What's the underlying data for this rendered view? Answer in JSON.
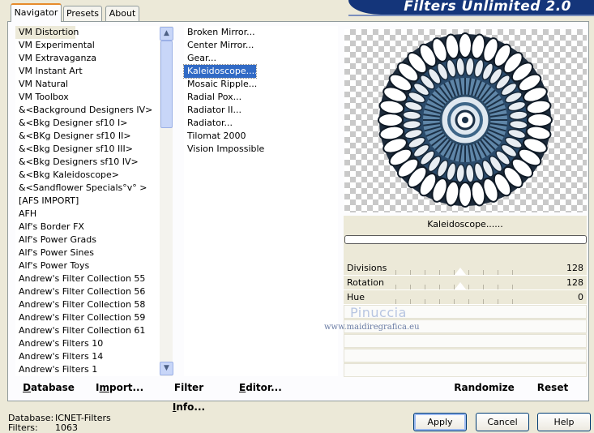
{
  "banner": {
    "title": "Filters Unlimited 2.0"
  },
  "tabs": [
    {
      "label": "Navigator",
      "active": true
    },
    {
      "label": "Presets",
      "active": false
    },
    {
      "label": "About",
      "active": false
    }
  ],
  "categories": [
    "VM Distortion",
    "VM Experimental",
    "VM Extravaganza",
    "VM Instant Art",
    "VM Natural",
    "VM Toolbox",
    "&<Background Designers IV>",
    "&<Bkg Designer sf10 I>",
    "&<BKg Designer sf10 II>",
    "&<Bkg Designer sf10 III>",
    "&<Bkg Designers sf10 IV>",
    "&<Bkg Kaleidoscope>",
    "&<Sandflower Specials°v° >",
    "[AFS IMPORT]",
    "AFH",
    "Alf's Border FX",
    "Alf's Power Grads",
    "Alf's Power Sines",
    "Alf's Power Toys",
    "Andrew's Filter Collection 55",
    "Andrew's Filter Collection 56",
    "Andrew's Filter Collection 58",
    "Andrew's Filter Collection 59",
    "Andrew's Filter Collection 61",
    "Andrew's Filters 10",
    "Andrew's Filters 14",
    "Andrew's Filters 1"
  ],
  "filters": [
    "Broken Mirror...",
    "Center Mirror...",
    "Gear...",
    "Kaleidoscope......",
    "Mosaic Ripple...",
    "Radial Pox...",
    "Radiator II...",
    "Radiator...",
    "Tilomat 2000",
    "Vision Impossible"
  ],
  "selected_filter_name": "Kaleidoscope......",
  "params": [
    {
      "label": "Divisions",
      "value": "128",
      "level": 128
    },
    {
      "label": "Rotation",
      "value": "128",
      "level": 128
    },
    {
      "label": "Hue",
      "value": "0",
      "level": 0
    }
  ],
  "watermark": {
    "name": "Pinuccia",
    "url": "www.maidiregrafica.eu"
  },
  "toolbar": {
    "database": {
      "hot": "D",
      "rest": "atabase"
    },
    "import": {
      "pre": "I",
      "hot": "m",
      "rest": "port..."
    },
    "filter_info": {
      "pre": "Filter ",
      "hot": "I",
      "rest": "nfo..."
    },
    "editor": {
      "hot": "E",
      "rest": "ditor..."
    },
    "randomize": "Randomize",
    "reset": "Reset"
  },
  "status": {
    "database_label": "Database:",
    "database_value": "ICNET-Filters",
    "filters_label": "Filters:",
    "filters_value": "1063"
  },
  "buttons": {
    "apply": "Apply",
    "cancel": "Cancel",
    "help": "Help"
  },
  "colors": {
    "accent": "#316ac5",
    "banner": "#14357a",
    "tab_highlight": "#e68b2c"
  }
}
